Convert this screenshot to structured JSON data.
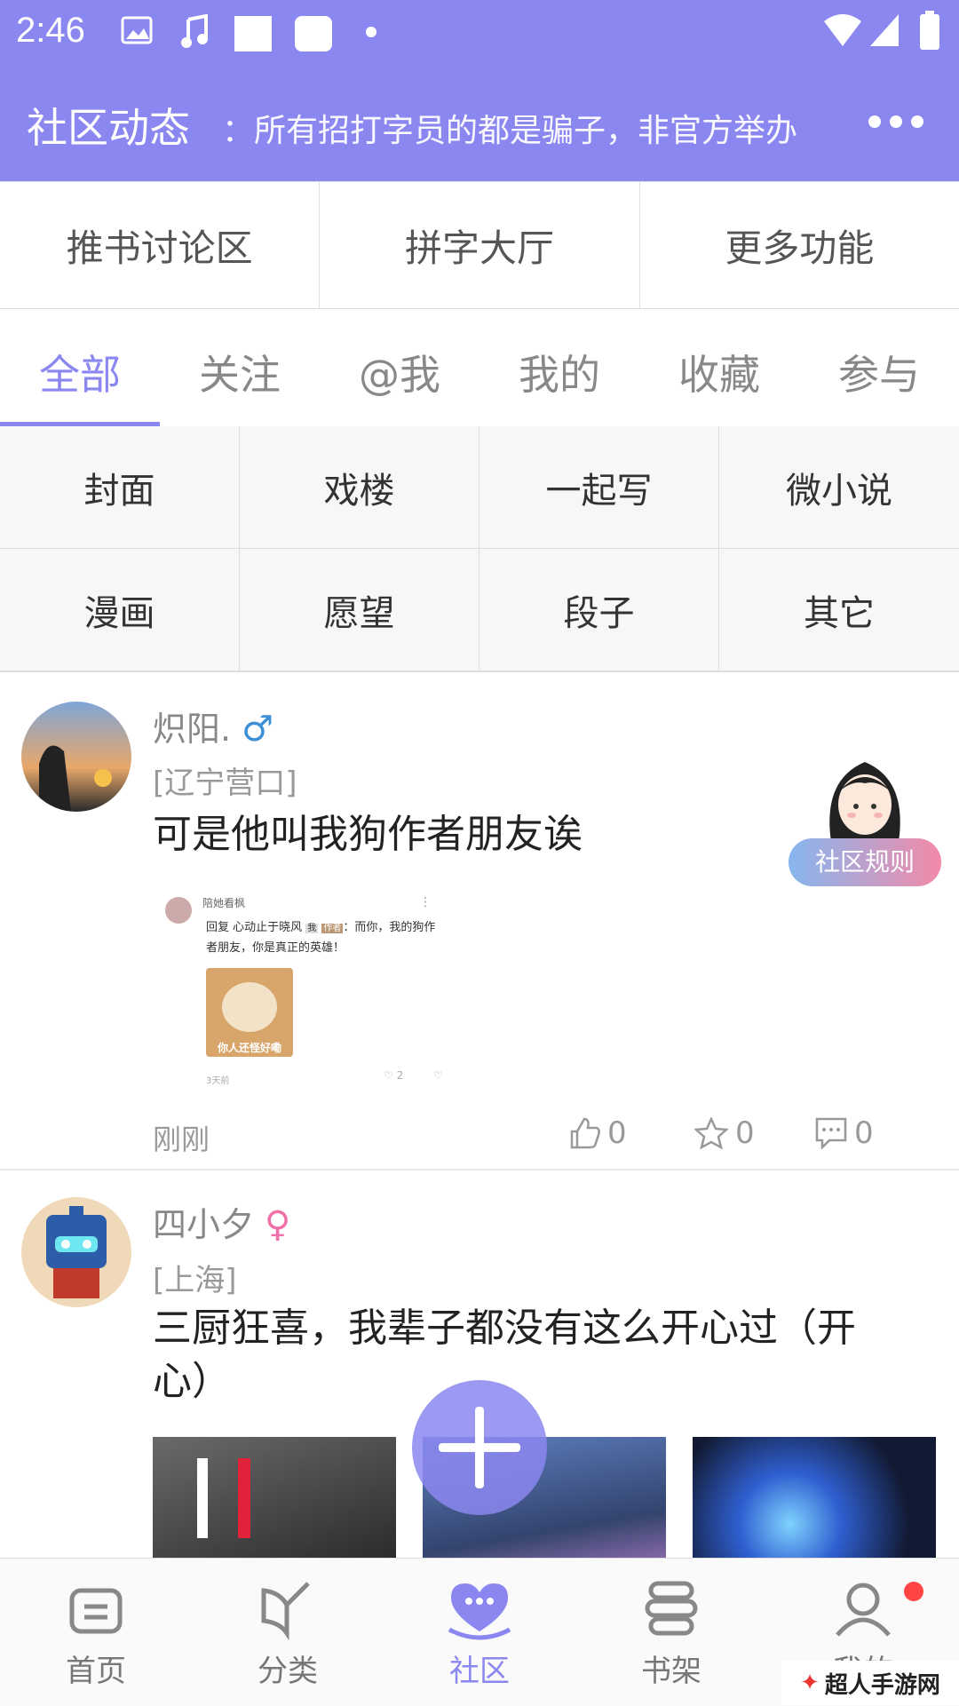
{
  "status": {
    "time": "2:46"
  },
  "appbar": {
    "title": "社区动态",
    "notice": "：所有招打字员的都是骗子，非官方举办"
  },
  "quick_links": [
    "推书讨论区",
    "拼字大厅",
    "更多功能"
  ],
  "tabs": [
    "全部",
    "关注",
    "@我",
    "我的",
    "收藏",
    "参与"
  ],
  "categories": [
    "封面",
    "戏楼",
    "一起写",
    "微小说",
    "漫画",
    "愿望",
    "段子",
    "其它"
  ],
  "posts": [
    {
      "name": "炽阳.",
      "gender": "♂",
      "location": "[辽宁营口]",
      "content": "可是他叫我狗作者朋友诶",
      "time": "刚刚",
      "likes": "0",
      "stars": "0",
      "comments": "0",
      "screenshot": {
        "user": "陪她看枫",
        "reply": "回复 心动止于晓风",
        "tag1": "我",
        "tag2": "作者",
        "text": "：而你，我的狗作者朋友，你是真正的英雄！",
        "meme": "你人还怪好嘞",
        "ago": "3天前",
        "likes": "2"
      }
    },
    {
      "name": "四小夕",
      "gender": "♀",
      "location": "[上海]",
      "content": "三厨狂喜，我辈子都没有这么开心过（开心）"
    }
  ],
  "rules_badge": "社区规则",
  "bottom_nav": [
    "首页",
    "分类",
    "社区",
    "书架",
    "我的"
  ],
  "watermark": "超人手游网",
  "colors": {
    "accent": "#8b87f0"
  }
}
